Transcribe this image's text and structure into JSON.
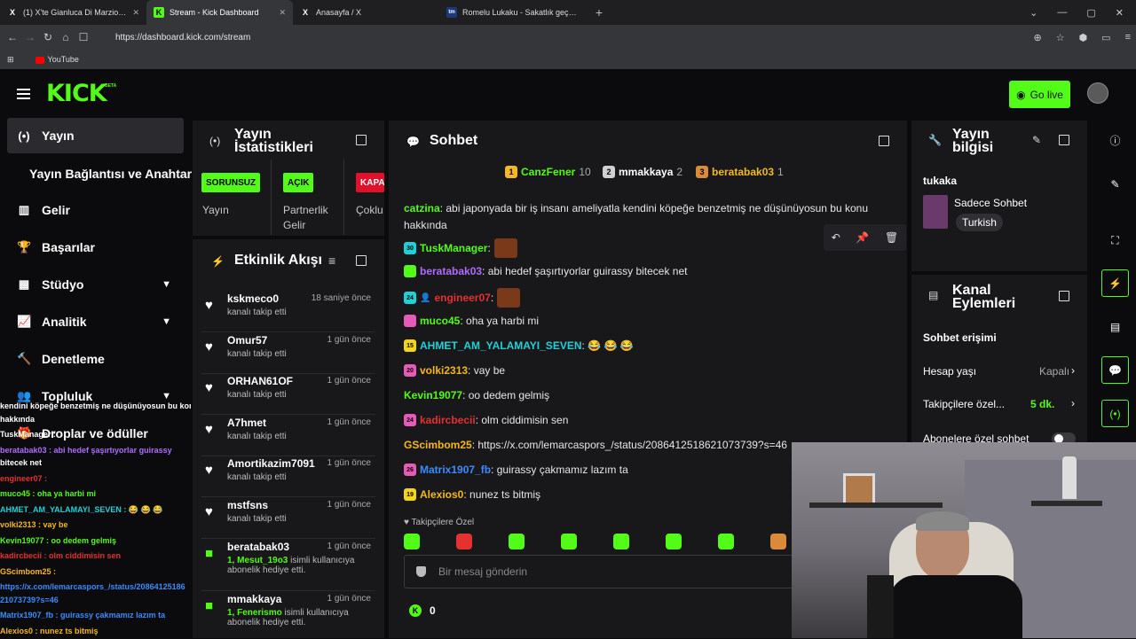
{
  "browser": {
    "tabs": [
      {
        "title": "(1) X'te Gianluca Di Marzio: \"@scnasi",
        "icon": "x-logo-icon",
        "active": false
      },
      {
        "title": "Stream - Kick Dashboard",
        "icon": "kick-logo-icon",
        "active": true
      },
      {
        "title": "Anasayfa / X",
        "icon": "x-logo-icon",
        "active": false
      },
      {
        "title": "Romelu Lukaku - Sakatlık geçmişi | Tr",
        "icon": "tm-logo-icon",
        "active": false
      }
    ],
    "url": "https://dashboard.kick.com/stream",
    "bookmark": "YouTube"
  },
  "header": {
    "logo": "KICK",
    "beta": "BETA",
    "go_live": "Go live"
  },
  "sidebar": {
    "items": [
      {
        "label": "Yayın",
        "icon": "broadcast-icon"
      },
      {
        "label": "Gelir",
        "icon": "chart-icon"
      },
      {
        "label": "Başarılar",
        "icon": "trophy-icon"
      },
      {
        "label": "Stüdyo",
        "icon": "studio-icon"
      },
      {
        "label": "Analitik",
        "icon": "analytics-icon"
      },
      {
        "label": "Denetleme",
        "icon": "moderation-icon"
      },
      {
        "label": "Topluluk",
        "icon": "community-icon"
      },
      {
        "label": "Droplar ve ödüller",
        "icon": "gift-icon"
      }
    ],
    "sub": "Yayın Bağlantısı ve Anahtarı"
  },
  "overlay_chat": [
    "kendini köpeğe benzetmiş ne düşünüyosun bu konu",
    "hakkında",
    "TuskManager :",
    "beratabak03 : abi hedef şaşırtıyorlar guirassy",
    "bitecek net",
    "engineer07 :",
    "muco45 : oha ya harbi mi",
    "AHMET_AM_YALAMAYI_SEVEN : 😂 😂 😂",
    "volki2313 : vay be",
    "Kevin19077 : oo dedem gelmiş",
    "kadircbecii : olm ciddimisin sen",
    "GScimbom25 :",
    "https://x.com/lemarcaspors_/status/20864125186",
    "21073739?s=46",
    "Matrix1907_fb : guirassy çakmamız lazım ta",
    "Alexios0 : nunez ts bitmiş"
  ],
  "stats": {
    "title": "Yayın İstatistikleri",
    "cols": [
      {
        "badge": "SORUNSUZ",
        "label": "Yayın",
        "color": "#53fc18"
      },
      {
        "badge": "AÇIK",
        "label": "Partnerlik Gelir",
        "color": "#53fc18"
      },
      {
        "badge": "KAPALI",
        "label": "Çoklu Yayın",
        "color": "#e0122b"
      }
    ]
  },
  "activity": {
    "title": "Etkinlik Akışı",
    "items": [
      {
        "name": "kskmeco0",
        "sub": "kanalı takip etti",
        "time": "18 saniye önce",
        "type": "follow"
      },
      {
        "name": "Omur57",
        "sub": "kanalı takip etti",
        "time": "1 gün önce",
        "type": "follow"
      },
      {
        "name": "ORHAN61OF",
        "sub": "kanalı takip etti",
        "time": "1 gün önce",
        "type": "follow"
      },
      {
        "name": "A7hmet",
        "sub": "kanalı takip etti",
        "time": "1 gün önce",
        "type": "follow"
      },
      {
        "name": "Amortikazim7091",
        "sub": "kanalı takip etti",
        "time": "1 gün önce",
        "type": "follow"
      },
      {
        "name": "mstfsns",
        "sub": "kanalı takip etti",
        "time": "1 gün önce",
        "type": "follow"
      },
      {
        "name": "beratabak03",
        "sub_hl": "1, Mesut_19o3",
        "sub": " isimli kullanıcıya",
        "sub2": "abonelik hediye etti.",
        "time": "1 gün önce",
        "type": "gift"
      },
      {
        "name": "mmakkaya",
        "sub_hl": "1, Fenerismo",
        "sub": " isimli kullanıcıya",
        "sub2": "abonelik hediye etti.",
        "time": "1 gün önce",
        "type": "gift"
      }
    ]
  },
  "chat": {
    "title": "Sohbet",
    "leaders": [
      {
        "name": "CanzFener",
        "count": "10",
        "rank": "1",
        "color": "#f5b81f"
      },
      {
        "name": "mmakkaya",
        "count": "2",
        "rank": "2",
        "color": "#d0d0d0"
      },
      {
        "name": "beratabak03",
        "count": "1",
        "rank": "3",
        "color": "#d98b3a"
      }
    ],
    "messages": [
      {
        "user": "catzina",
        "text": ": abi japonyada bir iş insanı ameliyatla kendini köpeğe benzetmiş ne düşünüyosun bu konu",
        "text2": "hakkında",
        "color": "#53fc18",
        "badge": ""
      },
      {
        "user": "TuskManager",
        "text": ":",
        "color": "#53fc18",
        "badge": "30",
        "badge_color": "#1fd1d6",
        "emote": true
      },
      {
        "user": "beratabak03",
        "text": ": abi hedef şaşırtıyorlar guirassy bitecek net",
        "color": "#b06cff",
        "badge": "gift",
        "badge_color": "#53fc18"
      },
      {
        "user": "engineer07",
        "text": ":",
        "color": "#e5312f",
        "badge": "24",
        "badge_color": "#1fd1d6",
        "emote": true
      },
      {
        "user": "muco45",
        "text": ": oha ya harbi mi",
        "color": "#53fc18",
        "badge": "sub",
        "badge_color": "#e85ab7"
      },
      {
        "user": "AHMET_AM_YALAMAYI_SEVEN",
        "text": ":  😂 😂 😂",
        "color": "#1fd1d6",
        "badge": "15",
        "badge_color": "#f5d517"
      },
      {
        "user": "volki2313",
        "text": ": vay be",
        "color": "#f5b81f",
        "badge": "20",
        "badge_color": "#e85ab7"
      },
      {
        "user": "Kevin19077",
        "text": ": oo dedem gelmiş",
        "color": "#53fc18",
        "badge": ""
      },
      {
        "user": "kadircbecii",
        "text": ": olm ciddimisin sen",
        "color": "#e5312f",
        "badge": "24",
        "badge_color": "#e85ab7"
      },
      {
        "user": "GScimbom25",
        "text": ": https://x.com/lemarcaspors_/status/2086412518621073739?s=46",
        "color": "#f5b81f",
        "badge": ""
      },
      {
        "user": "Matrix1907_fb",
        "text": ": guirassy çakmamız lazım ta",
        "color": "#3a8cff",
        "badge": "26",
        "badge_color": "#e85ab7"
      },
      {
        "user": "Alexios0",
        "text": ": nunez ts bitmiş",
        "color": "#f5b81f",
        "badge": "19",
        "badge_color": "#f5d517"
      }
    ],
    "followers_only": "Takipçilere Özel",
    "input_placeholder": "Bir mesaj gönderin",
    "kick_count": "0"
  },
  "info": {
    "title": "Yayın bilgisi",
    "channel": "tukaka",
    "stream_title": "Sadece Sohbet",
    "tag": "Turkish"
  },
  "actions": {
    "title": "Kanal Eylemleri",
    "section": "Sohbet erişimi",
    "rows": [
      {
        "label": "Hesap yaşı",
        "value": "Kapalı"
      },
      {
        "label": "Takipçilere özel...",
        "value": "5 dk."
      },
      {
        "label": "Abonelere özel sohbet",
        "value": ""
      }
    ]
  }
}
